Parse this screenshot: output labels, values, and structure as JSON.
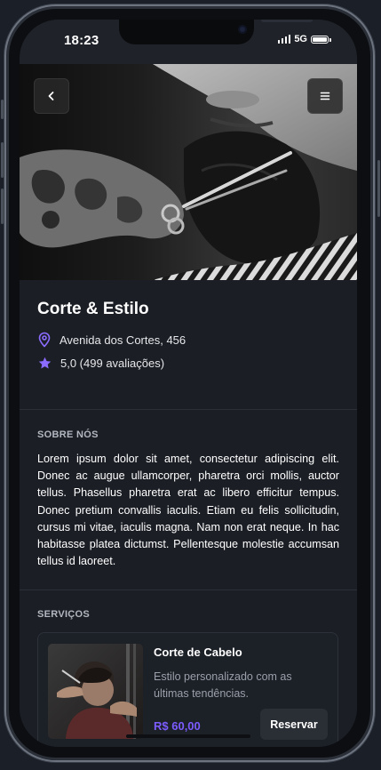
{
  "status_bar": {
    "time": "18:23",
    "network": "5G"
  },
  "hero": {
    "back_icon": "chevron-left-icon",
    "menu_icon": "hamburger-menu-icon"
  },
  "shop": {
    "name": "Corte & Estilo",
    "address": "Avenida dos Cortes, 456",
    "rating": "5,0 (499 avaliações)",
    "address_icon": "map-pin-icon",
    "rating_icon": "star-icon"
  },
  "about": {
    "title": "SOBRE NÓS",
    "text": "Lorem ipsum dolor sit amet, consectetur adipiscing elit. Donec ac augue ullamcorper, pharetra orci mollis, auctor tellus. Phasellus pharetra erat ac libero efficitur tempus. Donec pretium convallis iaculis. Etiam eu felis sollicitudin, cursus mi vitae, iaculis magna. Nam non erat neque. In hac habitasse platea dictumst. Pellentesque molestie accumsan tellus id laoreet."
  },
  "services": {
    "title": "SERVIÇOS",
    "items": [
      {
        "name": "Corte de Cabelo",
        "description": "Estilo personalizado com as últimas tendências.",
        "price": "R$ 60,00",
        "button_label": "Reservar"
      }
    ]
  },
  "colors": {
    "accent": "#7c5cff",
    "background": "#1b1e25",
    "card": "#1c2027"
  }
}
